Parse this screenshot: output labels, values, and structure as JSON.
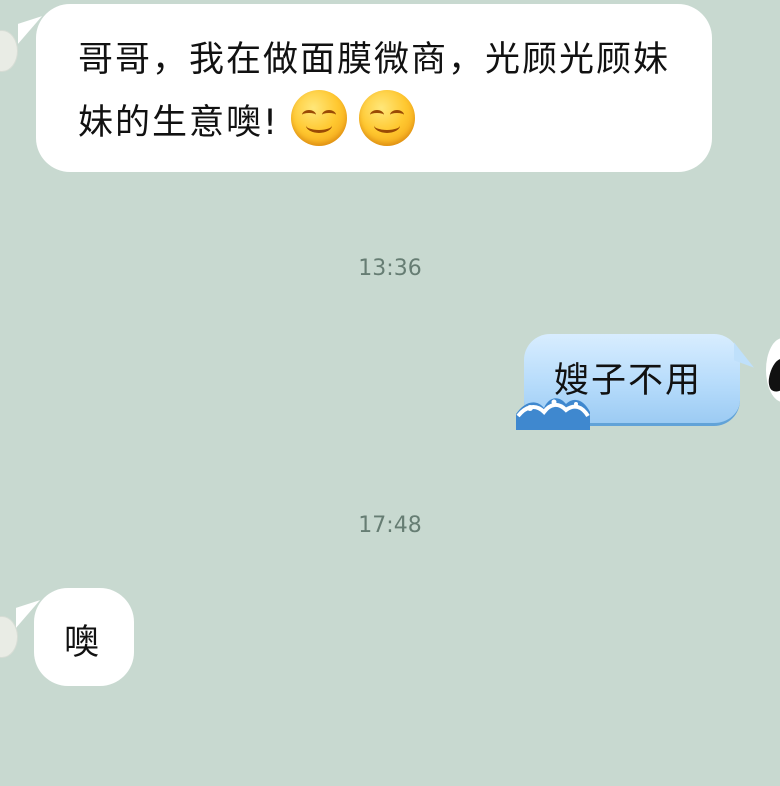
{
  "messages": [
    {
      "direction": "incoming",
      "text": "哥哥，我在做面膜微商，光顾光顾妹妹的生意噢!",
      "emojis": [
        "smile-emoji",
        "smile-emoji"
      ]
    },
    {
      "direction": "outgoing",
      "text": "嫂子不用"
    },
    {
      "direction": "incoming",
      "text": "噢"
    }
  ],
  "timestamps": [
    "13:36",
    "17:48"
  ],
  "colors": {
    "background": "#c8d9d0",
    "incoming_bubble": "#ffffff",
    "outgoing_bubble": "#b7dcfb",
    "timestamp_text": "#667d73"
  }
}
